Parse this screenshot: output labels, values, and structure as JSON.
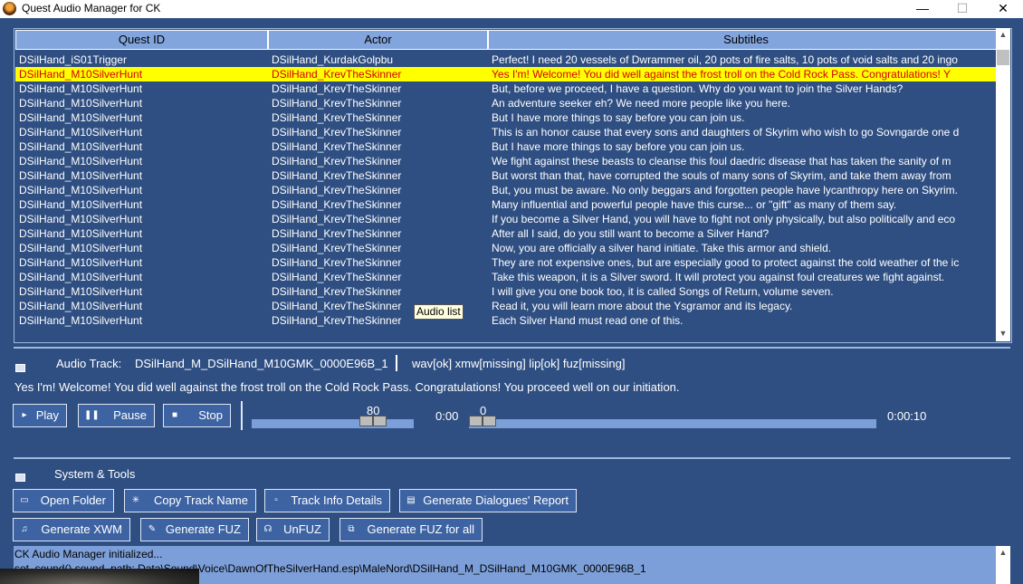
{
  "window": {
    "title": "Quest Audio Manager for CK",
    "min": "—",
    "max": "☐",
    "close": "✕"
  },
  "grid": {
    "columns": [
      "Quest ID",
      "Actor",
      "Subtitles"
    ],
    "rows": [
      [
        "DSilHand_iS01Trigger",
        "DSilHand_KurdakGolpbu",
        "Perfect! I need 20 vessels of Dwrammer oil, 20 pots of fire salts, 10 pots of void salts and 20 ingo"
      ],
      [
        "DSilHand_M10SilverHunt",
        "DSilHand_KrevTheSkinner",
        "Yes I'm! Welcome! You did well against the frost troll on the Cold Rock Pass. Congratulations! Y"
      ],
      [
        "DSilHand_M10SilverHunt",
        "DSilHand_KrevTheSkinner",
        "But, before we proceed, I have a question. Why do you want to join the Silver Hands?"
      ],
      [
        "DSilHand_M10SilverHunt",
        "DSilHand_KrevTheSkinner",
        "An adventure seeker eh? We need more people like you here."
      ],
      [
        "DSilHand_M10SilverHunt",
        "DSilHand_KrevTheSkinner",
        "But I have more things to say before you can join us."
      ],
      [
        "DSilHand_M10SilverHunt",
        "DSilHand_KrevTheSkinner",
        "This is an honor cause that every sons and daughters of Skyrim who wish to go Sovngarde one d"
      ],
      [
        "DSilHand_M10SilverHunt",
        "DSilHand_KrevTheSkinner",
        "But I have more things to say before you can join us."
      ],
      [
        "DSilHand_M10SilverHunt",
        "DSilHand_KrevTheSkinner",
        "We fight against these beasts to cleanse this foul daedric disease that has taken the sanity of m"
      ],
      [
        "DSilHand_M10SilverHunt",
        "DSilHand_KrevTheSkinner",
        "But worst than that, have corrupted the souls of many sons of Skyrim, and take them away from"
      ],
      [
        "DSilHand_M10SilverHunt",
        "DSilHand_KrevTheSkinner",
        "But, you must be aware. No only beggars and forgotten people have lycanthropy here on Skyrim."
      ],
      [
        "DSilHand_M10SilverHunt",
        "DSilHand_KrevTheSkinner",
        "Many influential and powerful  people have this curse... or \"gift\" as many of them say."
      ],
      [
        "DSilHand_M10SilverHunt",
        "DSilHand_KrevTheSkinner",
        "If you become a Silver Hand, you will have to fight not only physically, but also politically and eco"
      ],
      [
        "DSilHand_M10SilverHunt",
        "DSilHand_KrevTheSkinner",
        "After all I said, do you still want to become a Silver Hand?"
      ],
      [
        "DSilHand_M10SilverHunt",
        "DSilHand_KrevTheSkinner",
        "Now, you are officially a silver hand initiate. Take this armor and shield."
      ],
      [
        "DSilHand_M10SilverHunt",
        "DSilHand_KrevTheSkinner",
        "They are not expensive ones, but are especially good to protect against the cold weather of the ic"
      ],
      [
        "DSilHand_M10SilverHunt",
        "DSilHand_KrevTheSkinner",
        "Take this weapon, it is a Silver sword. It will protect you against foul creatures we fight against."
      ],
      [
        "DSilHand_M10SilverHunt",
        "DSilHand_KrevTheSkinner",
        "I will give you one book too, it is called Songs of Return, volume seven."
      ],
      [
        "DSilHand_M10SilverHunt",
        "DSilHand_KrevTheSkinner",
        "Read it, you will learn more about the Ysgramor and its legacy."
      ],
      [
        "DSilHand_M10SilverHunt",
        "DSilHand_KrevTheSkinner",
        "Each Silver Hand must read one of this."
      ]
    ],
    "selected_row": 1,
    "tooltip": "Audio list"
  },
  "audio": {
    "label": "Audio Track:",
    "track_name": "DSilHand_M_DSilHand_M10GMK_0000E96B_1",
    "status": "wav[ok] xmw[missing] lip[ok] fuz[missing]",
    "subtitle": "Yes I'm! Welcome! You did well against the frost troll on the Cold Rock Pass. Congratulations! You proceed well on our initiation."
  },
  "player": {
    "play": "Play",
    "pause": "Pause",
    "stop": "Stop",
    "volume": "80",
    "volume_fraction": 0.8,
    "time_start": "0:00",
    "position": "0",
    "position_fraction": 0.0,
    "time_end": "0:00:10"
  },
  "tools": {
    "title": "System & Tools",
    "open_folder": "Open Folder",
    "copy_track_name": "Copy Track Name",
    "track_info": "Track Info Details",
    "gen_report": "Generate Dialogues' Report",
    "gen_xwm": "Generate XWM",
    "gen_fuz": "Generate FUZ",
    "unfuz": "UnFUZ",
    "gen_fuz_all": "Generate FUZ for all"
  },
  "log": {
    "lines": [
      "CK Audio Manager initialized...",
      "set_sound() sound_path: Data\\Sound\\Voice\\DawnOfTheSilverHand.esp\\MaleNord\\DSilHand_M_DSilHand_M10GMK_0000E96B_1"
    ]
  }
}
